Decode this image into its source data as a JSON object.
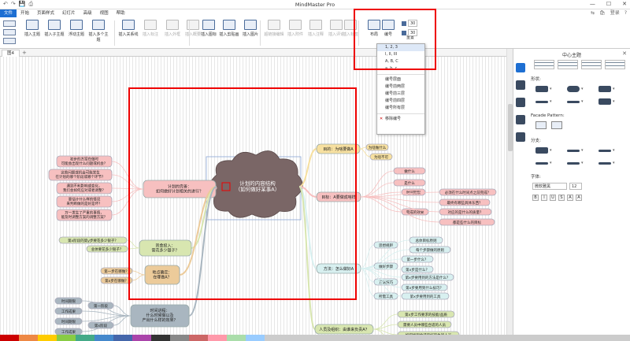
{
  "app": {
    "title": "MindMaster Pro",
    "window_buttons": [
      "—",
      "☐",
      "✕"
    ],
    "qat": [
      "↶",
      "↷",
      "💾",
      "⎙"
    ]
  },
  "menu": {
    "items": [
      "文件",
      "开始",
      "页面样式",
      "幻灯片",
      "高级",
      "视图",
      "帮助"
    ],
    "right": [
      "⇆",
      "🛍",
      "登录",
      "?"
    ]
  },
  "ribbon": {
    "buttons": [
      "插入主题",
      "插入子主题",
      "浮动主题",
      "插入多个主题",
      "插入关系线",
      "插入标注",
      "插入外框",
      "插入概要",
      "插入图标",
      "插入剪贴画",
      "插入图片",
      "超链接编辑",
      "插入附件",
      "插入注释",
      "插入评论",
      "插入标签",
      "布局",
      "编号",
      "重置"
    ],
    "spin_values": [
      "30",
      "30"
    ],
    "dim_flags": [
      false,
      false,
      false,
      false,
      false,
      true,
      true,
      true,
      false,
      false,
      false,
      true,
      true,
      true,
      true,
      true,
      false,
      false,
      false
    ]
  },
  "numbering_dropdown": {
    "items": [
      "1, 2, 3",
      "I, II, III",
      "A, B, C",
      "a, b, c",
      "编号层面",
      "编号前两层",
      "编号前三层",
      "编号前四层",
      "编号所有层",
      "移除编号"
    ],
    "highlight_index": 0
  },
  "tabs": {
    "doc": "图4",
    "add": "+"
  },
  "right_panel": {
    "title": "中心主题",
    "close": "✕",
    "shape_label": "形状:",
    "facade_label": "Facade Pattern:",
    "branch_label": "分支:",
    "font_label": "字体:",
    "font_name": "微软雅黑",
    "font_size": "12",
    "fmt_buttons": [
      "B",
      "I",
      "U",
      "S",
      "A",
      "A"
    ]
  },
  "mindmap": {
    "center": [
      "计划的内容结构",
      "（如何做好某事A）"
    ],
    "left_topics": [
      {
        "text": [
          "计划的完善：",
          "如何做好计划相关的进行？"
        ],
        "color": "#f7c0c0"
      },
      {
        "text": [
          "资金投入：",
          "需花多少银子？"
        ],
        "color": "#d8e6b0"
      },
      {
        "text": [
          "地点确定：",
          "在哪做A？"
        ],
        "color": "#eccb9a"
      },
      {
        "text": [
          "时间进程：",
          "什么时候做以及",
          "产出什么样的效果？"
        ],
        "color": "#a9b6c0"
      }
    ],
    "left_subs": [
      [
        "初步的方案在做时",
        "可能会出现什么问题或机会？"
      ],
      [
        "这些问题或机会可能发生",
        "在计划的哪个阶段或哪个环节？"
      ],
      [
        "遇到不利影响或变化，",
        "我们会如何应对或者调整？"
      ],
      [
        "要估计什么样的情况",
        "来判断做的是好是坏？"
      ],
      [
        "万一发生了严重的事情，",
        "能及时调整方案的调整方案？"
      ],
      "第x阶段的第y步要花多少银子？",
      "总体要花多少银子？",
      "第一步在哪做？",
      "第x步在哪做？",
      "时间期限",
      "工作成果",
      "时间期限",
      "工作成果",
      "第一阶段",
      "第x阶段"
    ],
    "right_topics": [
      {
        "text": "目的：为啥要做A",
        "color": "#f7e0a0"
      },
      {
        "text": "目标：A要做成啥样",
        "color": "#f7c0c0"
      },
      {
        "text": "方法：怎么做好A",
        "color": "#d8f0f0"
      },
      {
        "text": "人员及组织：由谁来负责A？",
        "color": "#d8e6b0"
      }
    ],
    "right_subs": [
      "为啥做什么",
      "为啥不可",
      "做什么",
      "是什么",
      "时间期限",
      "完成的效果",
      "必须在什么时间点之前完成？",
      "最终有哪些具体东西？",
      "对应的是什么的质量？",
      "都是些什么的目标",
      "思想规则",
      "总体目标原则",
      "每个步骤做的原则",
      "做好步骤",
      "第一步什么？",
      "第x步是什么？",
      "方法技巧",
      "第x步要用到的方法是什么？",
      "第x步要用到什么技巧？",
      "所需工具",
      "第x步要用到的工具",
      "第x步工作要求的技能/品质",
      "需要人员中哪些合适的人员",
      "如何找到合适的好的执行人员",
      "整个团队要如何配合工作"
    ]
  },
  "colors": {
    "accent": "#1e6fd2",
    "red_box": "#e00000"
  }
}
